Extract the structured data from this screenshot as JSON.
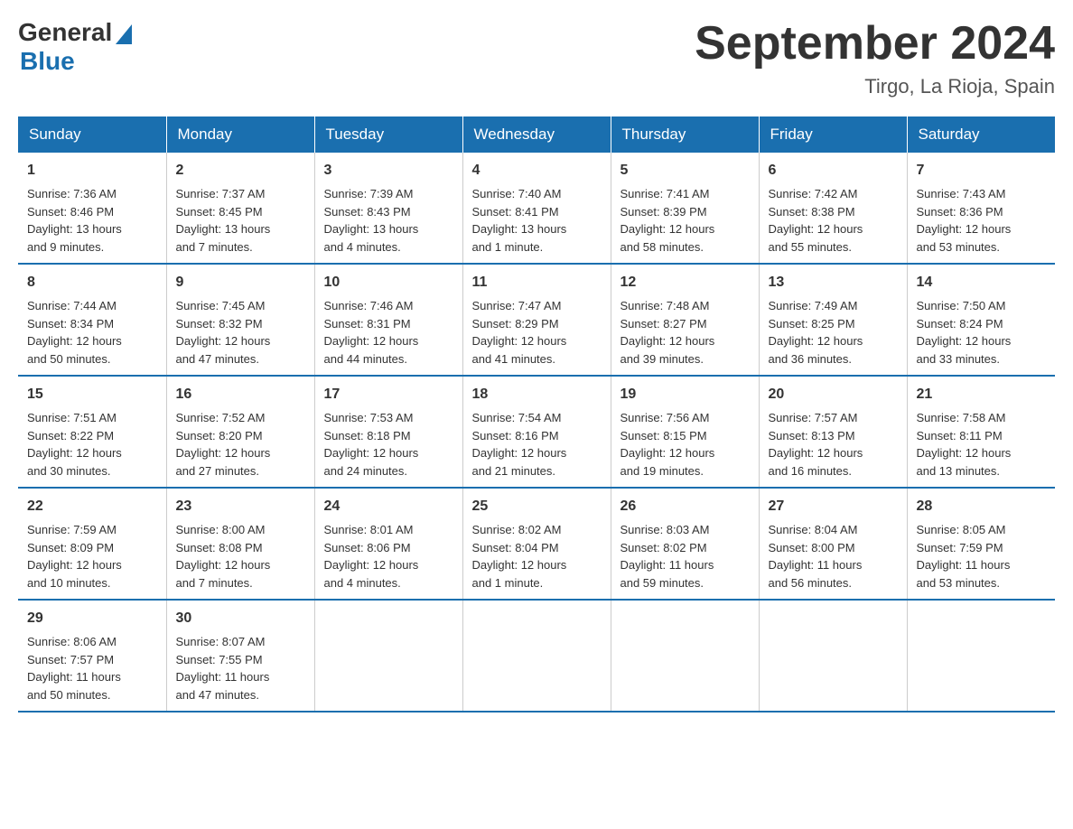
{
  "logo": {
    "general": "General",
    "blue": "Blue"
  },
  "title": "September 2024",
  "subtitle": "Tirgo, La Rioja, Spain",
  "days_of_week": [
    "Sunday",
    "Monday",
    "Tuesday",
    "Wednesday",
    "Thursday",
    "Friday",
    "Saturday"
  ],
  "weeks": [
    [
      {
        "day": "1",
        "info": "Sunrise: 7:36 AM\nSunset: 8:46 PM\nDaylight: 13 hours\nand 9 minutes."
      },
      {
        "day": "2",
        "info": "Sunrise: 7:37 AM\nSunset: 8:45 PM\nDaylight: 13 hours\nand 7 minutes."
      },
      {
        "day": "3",
        "info": "Sunrise: 7:39 AM\nSunset: 8:43 PM\nDaylight: 13 hours\nand 4 minutes."
      },
      {
        "day": "4",
        "info": "Sunrise: 7:40 AM\nSunset: 8:41 PM\nDaylight: 13 hours\nand 1 minute."
      },
      {
        "day": "5",
        "info": "Sunrise: 7:41 AM\nSunset: 8:39 PM\nDaylight: 12 hours\nand 58 minutes."
      },
      {
        "day": "6",
        "info": "Sunrise: 7:42 AM\nSunset: 8:38 PM\nDaylight: 12 hours\nand 55 minutes."
      },
      {
        "day": "7",
        "info": "Sunrise: 7:43 AM\nSunset: 8:36 PM\nDaylight: 12 hours\nand 53 minutes."
      }
    ],
    [
      {
        "day": "8",
        "info": "Sunrise: 7:44 AM\nSunset: 8:34 PM\nDaylight: 12 hours\nand 50 minutes."
      },
      {
        "day": "9",
        "info": "Sunrise: 7:45 AM\nSunset: 8:32 PM\nDaylight: 12 hours\nand 47 minutes."
      },
      {
        "day": "10",
        "info": "Sunrise: 7:46 AM\nSunset: 8:31 PM\nDaylight: 12 hours\nand 44 minutes."
      },
      {
        "day": "11",
        "info": "Sunrise: 7:47 AM\nSunset: 8:29 PM\nDaylight: 12 hours\nand 41 minutes."
      },
      {
        "day": "12",
        "info": "Sunrise: 7:48 AM\nSunset: 8:27 PM\nDaylight: 12 hours\nand 39 minutes."
      },
      {
        "day": "13",
        "info": "Sunrise: 7:49 AM\nSunset: 8:25 PM\nDaylight: 12 hours\nand 36 minutes."
      },
      {
        "day": "14",
        "info": "Sunrise: 7:50 AM\nSunset: 8:24 PM\nDaylight: 12 hours\nand 33 minutes."
      }
    ],
    [
      {
        "day": "15",
        "info": "Sunrise: 7:51 AM\nSunset: 8:22 PM\nDaylight: 12 hours\nand 30 minutes."
      },
      {
        "day": "16",
        "info": "Sunrise: 7:52 AM\nSunset: 8:20 PM\nDaylight: 12 hours\nand 27 minutes."
      },
      {
        "day": "17",
        "info": "Sunrise: 7:53 AM\nSunset: 8:18 PM\nDaylight: 12 hours\nand 24 minutes."
      },
      {
        "day": "18",
        "info": "Sunrise: 7:54 AM\nSunset: 8:16 PM\nDaylight: 12 hours\nand 21 minutes."
      },
      {
        "day": "19",
        "info": "Sunrise: 7:56 AM\nSunset: 8:15 PM\nDaylight: 12 hours\nand 19 minutes."
      },
      {
        "day": "20",
        "info": "Sunrise: 7:57 AM\nSunset: 8:13 PM\nDaylight: 12 hours\nand 16 minutes."
      },
      {
        "day": "21",
        "info": "Sunrise: 7:58 AM\nSunset: 8:11 PM\nDaylight: 12 hours\nand 13 minutes."
      }
    ],
    [
      {
        "day": "22",
        "info": "Sunrise: 7:59 AM\nSunset: 8:09 PM\nDaylight: 12 hours\nand 10 minutes."
      },
      {
        "day": "23",
        "info": "Sunrise: 8:00 AM\nSunset: 8:08 PM\nDaylight: 12 hours\nand 7 minutes."
      },
      {
        "day": "24",
        "info": "Sunrise: 8:01 AM\nSunset: 8:06 PM\nDaylight: 12 hours\nand 4 minutes."
      },
      {
        "day": "25",
        "info": "Sunrise: 8:02 AM\nSunset: 8:04 PM\nDaylight: 12 hours\nand 1 minute."
      },
      {
        "day": "26",
        "info": "Sunrise: 8:03 AM\nSunset: 8:02 PM\nDaylight: 11 hours\nand 59 minutes."
      },
      {
        "day": "27",
        "info": "Sunrise: 8:04 AM\nSunset: 8:00 PM\nDaylight: 11 hours\nand 56 minutes."
      },
      {
        "day": "28",
        "info": "Sunrise: 8:05 AM\nSunset: 7:59 PM\nDaylight: 11 hours\nand 53 minutes."
      }
    ],
    [
      {
        "day": "29",
        "info": "Sunrise: 8:06 AM\nSunset: 7:57 PM\nDaylight: 11 hours\nand 50 minutes."
      },
      {
        "day": "30",
        "info": "Sunrise: 8:07 AM\nSunset: 7:55 PM\nDaylight: 11 hours\nand 47 minutes."
      },
      {
        "day": "",
        "info": ""
      },
      {
        "day": "",
        "info": ""
      },
      {
        "day": "",
        "info": ""
      },
      {
        "day": "",
        "info": ""
      },
      {
        "day": "",
        "info": ""
      }
    ]
  ]
}
